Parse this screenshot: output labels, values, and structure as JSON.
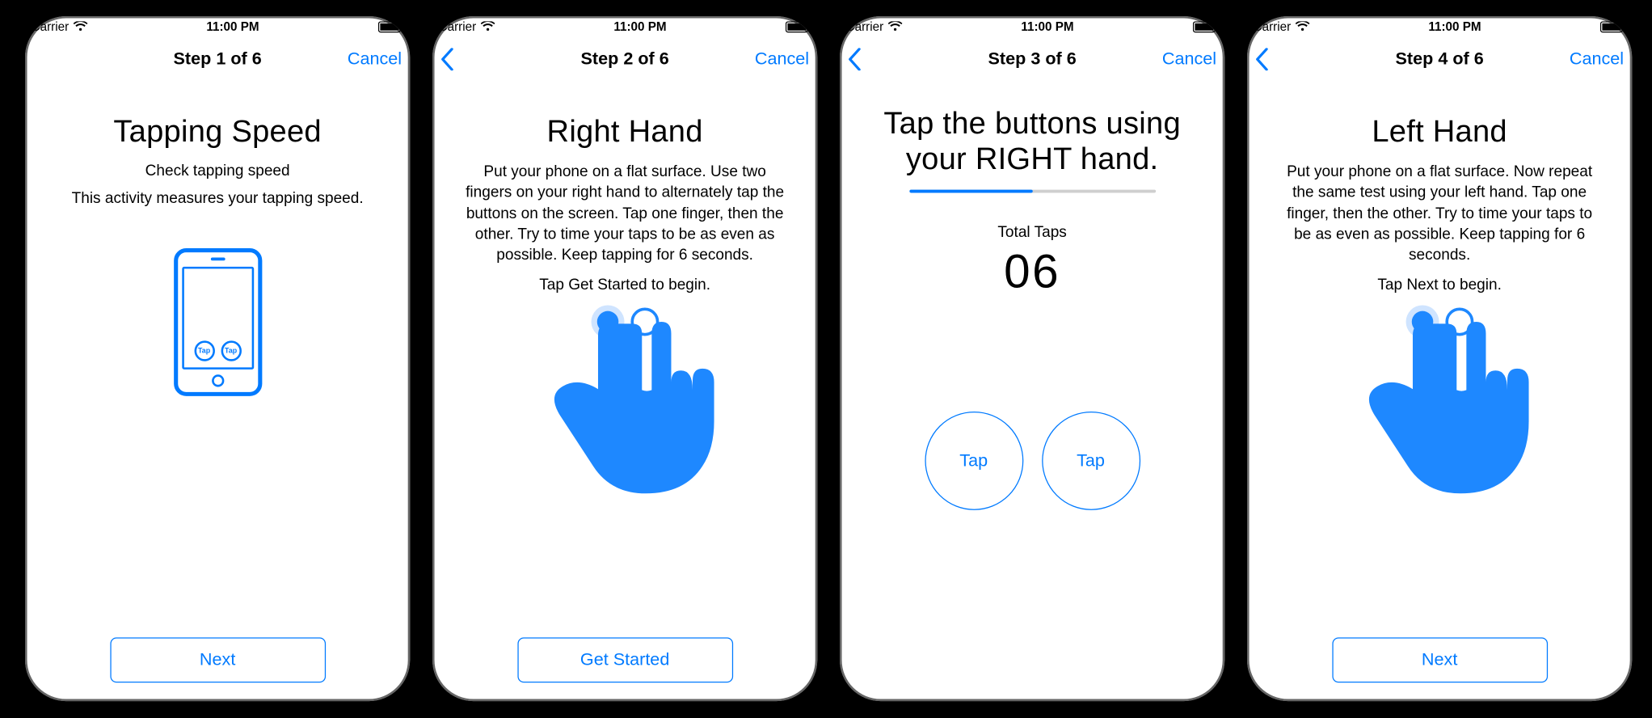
{
  "carrier": "Carrier",
  "time": "11:00 PM",
  "accent_color": "#007AFF",
  "screens": [
    {
      "step_label": "Step 1 of 6",
      "show_back": false,
      "cancel_label": "Cancel",
      "title": "Tapping Speed",
      "lines": [
        "Check tapping speed",
        "This activity measures your tapping speed."
      ],
      "illus_tap_label": "Tap",
      "button": "Next"
    },
    {
      "step_label": "Step 2 of 6",
      "show_back": true,
      "cancel_label": "Cancel",
      "title": "Right Hand",
      "lines": [
        "Put your phone on a flat surface. Use two fingers on your right hand to alternately tap the buttons on the screen. Tap one finger, then the other. Try to time your taps to be as even as possible. Keep tapping for 6 seconds.",
        "Tap Get Started to begin."
      ],
      "button": "Get Started"
    },
    {
      "step_label": "Step 3 of 6",
      "show_back": true,
      "cancel_label": "Cancel",
      "title": "Tap the buttons using your RIGHT hand.",
      "total_taps_label": "Total Taps",
      "total_taps_value": "06",
      "progress_fraction": 0.5,
      "tap_button_label": "Tap"
    },
    {
      "step_label": "Step 4 of 6",
      "show_back": true,
      "cancel_label": "Cancel",
      "title": "Left Hand",
      "lines": [
        "Put your phone on a flat surface. Now repeat the same test using your left hand. Tap one finger, then the other. Try to time your taps to be as even as possible. Keep tapping for 6 seconds.",
        "Tap Next to begin."
      ],
      "button": "Next"
    }
  ]
}
